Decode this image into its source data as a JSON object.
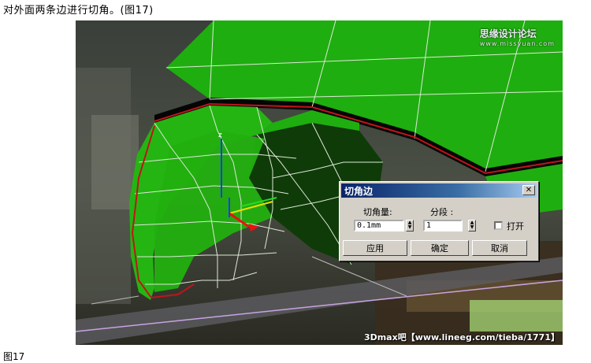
{
  "caption_top": "对外面两条边进行切角。(图17)",
  "caption_bottom": "图17",
  "watermark_top": "思缘设计论坛",
  "watermark_top_sub": "www.missyuan.com",
  "watermark_bottom": "3Dmax吧【www.lineeg.com/tieba/1771】",
  "axis_labels": {
    "z": "z"
  },
  "dialog": {
    "title": "切角边",
    "close_glyph": "✕",
    "amount_label": "切角量:",
    "amount_value": "0.1mm",
    "segments_label": "分段 :",
    "segments_value": "1",
    "open_label": "打开",
    "open_checked": false,
    "apply_label": "应用",
    "ok_label": "确定",
    "cancel_label": "取消"
  },
  "colors": {
    "mesh_green": "#1fae0f",
    "mesh_dark": "#0f3b08",
    "edge_red": "#c0141c",
    "dialog_title": "#0a246a"
  }
}
